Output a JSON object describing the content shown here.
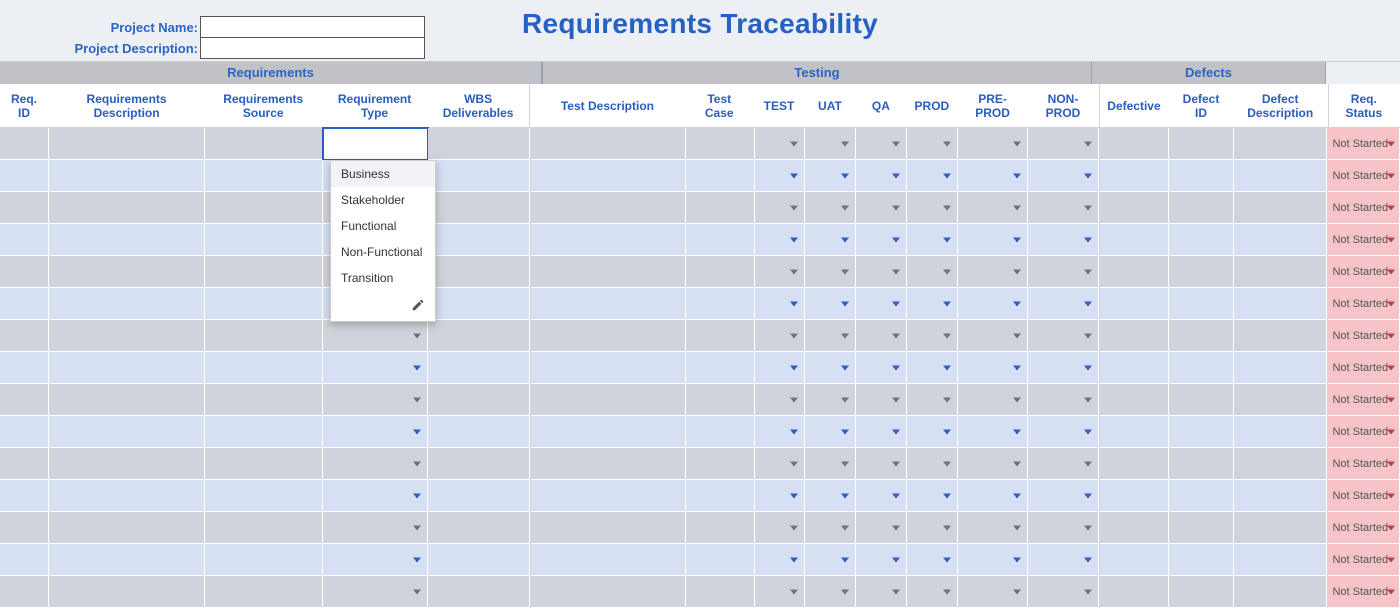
{
  "title": "Requirements Traceability",
  "meta": {
    "project_name_label": "Project Name:",
    "project_name_value": "",
    "project_desc_label": "Project Description:",
    "project_desc_value": ""
  },
  "bands": {
    "requirements": "Requirements",
    "testing": "Testing",
    "defects": "Defects"
  },
  "columns": {
    "req_id": "Req. ID",
    "req_desc": "Requirements Description",
    "req_src": "Requirements Source",
    "req_type": "Requirement Type",
    "wbs": "WBS Deliverables",
    "test_desc": "Test Description",
    "test_case": "Test Case",
    "test": "TEST",
    "uat": "UAT",
    "qa": "QA",
    "prod": "PROD",
    "preprod": "PRE-PROD",
    "nonprod": "NON-PROD",
    "defective": "Defective",
    "defect_id": "Defect ID",
    "defect_desc": "Defect Description",
    "status": "Req. Status"
  },
  "dropdown": {
    "options": [
      "Business",
      "Stakeholder",
      "Functional",
      "Non-Functional",
      "Transition"
    ]
  },
  "status_default": "Not Started",
  "row_count": 15
}
